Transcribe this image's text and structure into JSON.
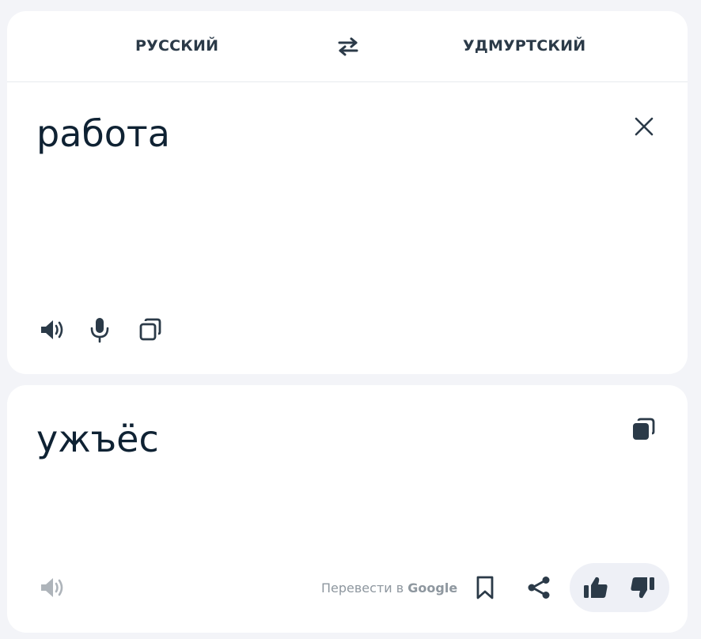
{
  "colors": {
    "background": "#f3f4f8",
    "card": "#ffffff",
    "text_primary": "#0f2233",
    "icon": "#2b3a48",
    "icon_muted": "#aeb4ba",
    "link_muted": "#8e979f",
    "feedback_pill": "#eef0f6"
  },
  "language_bar": {
    "source_language": "РУССКИЙ",
    "target_language": "УДМУРТСКИЙ",
    "swap_icon": "swap-arrows-icon"
  },
  "source": {
    "text": "работа",
    "icons": [
      "close-icon",
      "speaker-icon",
      "microphone-icon",
      "copy-icon"
    ]
  },
  "translation": {
    "text": "ужъёс",
    "google_link": {
      "prefix": "Перевести в",
      "brand": "Google"
    },
    "icons": [
      "copy-filled-icon",
      "speaker-icon",
      "bookmark-icon",
      "share-icon",
      "thumbs-up-icon",
      "thumbs-down-icon"
    ]
  }
}
